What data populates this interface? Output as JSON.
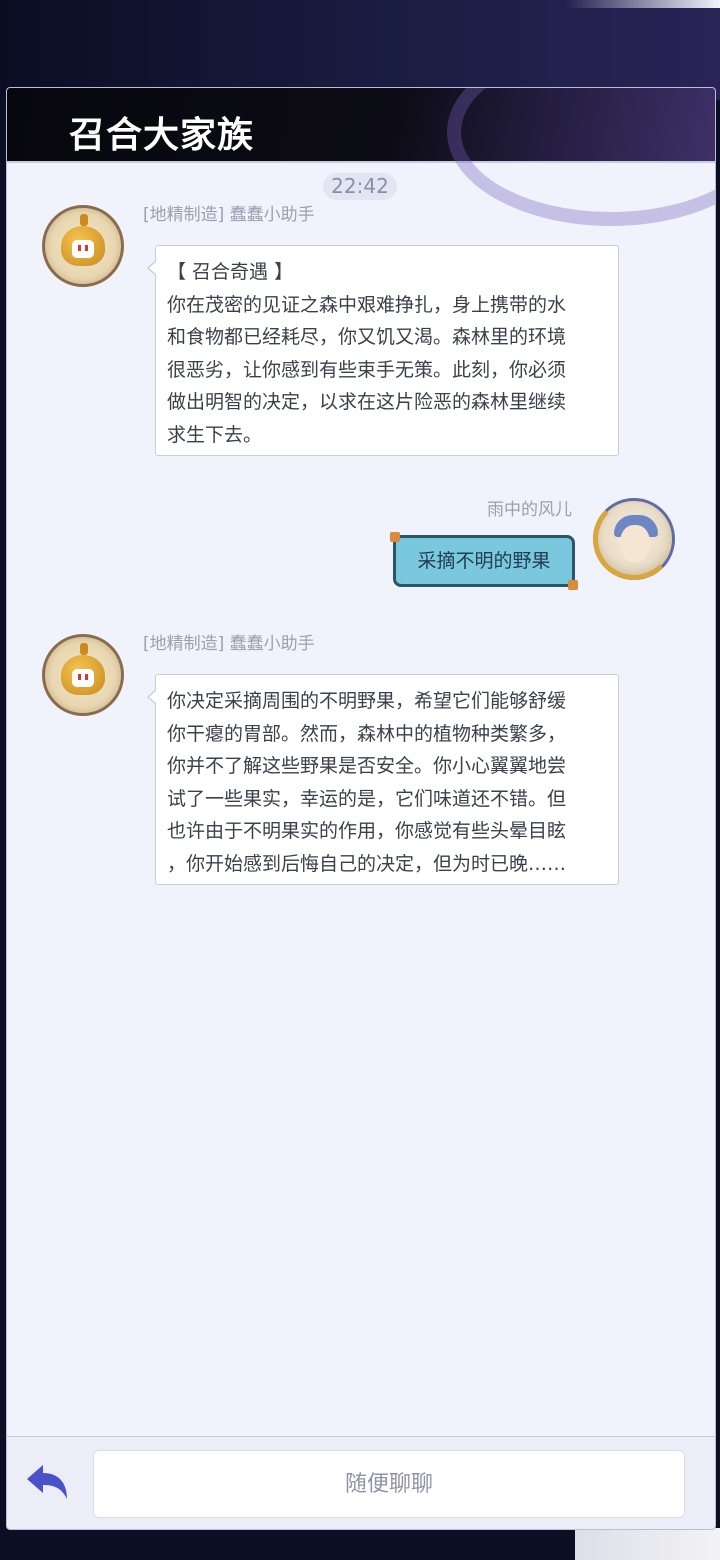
{
  "app": {
    "title": "召合大家族"
  },
  "chat": {
    "timestamp": "22:42",
    "messages": [
      {
        "sender": "[地精制造] 蠢蠢小助手",
        "side": "left",
        "avatar": "robot-avatar",
        "lines": [
          "【 召合奇遇 】",
          "你在茂密的见证之森中艰难挣扎，身上携带的水",
          "和食物都已经耗尽，你又饥又渴。森林里的环境",
          "很恶劣，让你感到有些束手无策。此刻，你必须",
          "做出明智的决定，以求在这片险恶的森林里继续",
          "求生下去。"
        ]
      },
      {
        "sender": "雨中的风儿",
        "side": "right",
        "avatar": "player-avatar",
        "text": "采摘不明的野果"
      },
      {
        "sender": "[地精制造] 蠢蠢小助手",
        "side": "left",
        "avatar": "robot-avatar",
        "lines": [
          "你决定采摘周围的不明野果，希望它们能够舒缓",
          "你干瘪的胃部。然而，森林中的植物种类繁多，",
          "你并不了解这些野果是否安全。你小心翼翼地尝",
          "试了一些果实，幸运的是，它们味道还不错。但",
          "也许由于不明果实的作用，你感觉有些头晕目眩",
          "，你开始感到后悔自己的决定，但为时已晚……"
        ]
      }
    ]
  },
  "input": {
    "placeholder": "随便聊聊"
  },
  "icons": {
    "back": "back-arrow-icon"
  },
  "colors": {
    "accent": "#4a52c9",
    "panel_bg": "#f1f3fc",
    "reply_bubble": "#7ac8de",
    "title_bar": "#0b0b14"
  }
}
